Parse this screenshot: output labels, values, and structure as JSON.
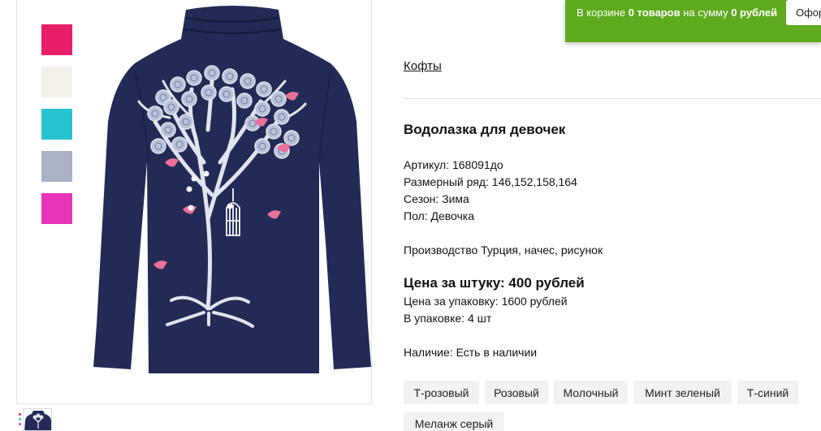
{
  "cart": {
    "prefix": "В корзине ",
    "count": "0 товаров",
    "middle": " на сумму ",
    "sum": "0 рублей",
    "checkout_label": "Оформить"
  },
  "gallery": {
    "swatch_colors": [
      "#e91e6a",
      "#f3f1ea",
      "#26c2cf",
      "#aab3c4",
      "#e735b8"
    ],
    "garment_color": "#232a55",
    "print_color": "#dfe4ef",
    "bird_color": "#e8709a"
  },
  "breadcrumb": "Кофты",
  "product": {
    "title": "Водолазка для девочек",
    "article": "Артикул: 168091до",
    "sizes": "Размерный ряд: 146,152,158,164",
    "season": "Сезон: Зима",
    "gender": "Пол: Девочка",
    "production": "Производство Турция, начес, рисунок",
    "price_unit": "Цена за штуку: 400 рублей",
    "price_pack": "Цена за упаковку: 1600 рублей",
    "pack_size": "В упаковке: 4 шт",
    "availability": "Наличие: Есть в наличии"
  },
  "variants": [
    "Т-розовый",
    "Розовый",
    "Молочный",
    "Минт зеленый",
    "Т-синий",
    "Меланж серый"
  ]
}
